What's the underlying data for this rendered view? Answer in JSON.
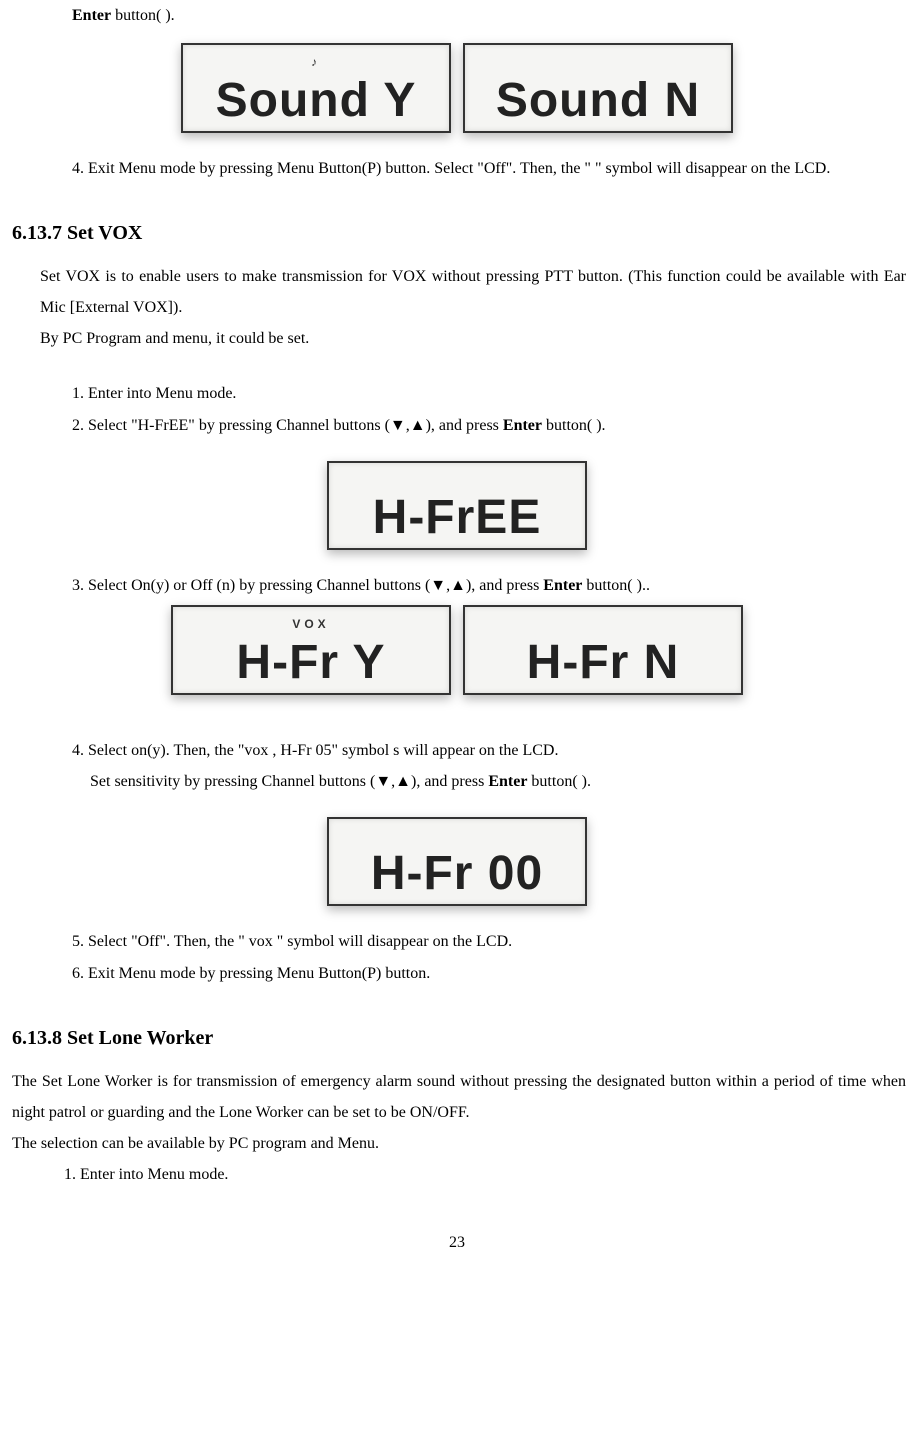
{
  "line_enter_frag_a": "Enter",
  "line_enter_frag_b": " button(      ).",
  "lcd_sound": {
    "top1": "♪",
    "left": "Sound Y",
    "right": "Sound N"
  },
  "step4_sound": "4. Exit Menu mode by pressing Menu Button(P) button. Select \"Off\". Then, the \"    \" symbol will disappear on the LCD.",
  "heading_vox": "6.13.7 Set VOX",
  "vox_intro1": "   Set VOX is to enable users to make transmission for VOX without pressing PTT button. (This function could be available with Ear Mic [External VOX]).",
  "vox_intro2": "By PC Program and menu, it could be set.",
  "vox_step1": "1. Enter into Menu mode.",
  "vox_step2_a": "2. Select \"H-FrEE\" by pressing Channel buttons (▼,▲), and press ",
  "vox_step2_b": "Enter",
  "vox_step2_c": " button(      ).",
  "lcd_hfree": {
    "text": "H-FrEE"
  },
  "vox_step3_a": "3. Select On(y) or Off (n) by pressing Channel buttons (▼,▲), and   press ",
  "vox_step3_b": "Enter",
  "vox_step3_c": " button(      )..",
  "lcd_hfr_yn": {
    "top": "VOX",
    "left": "H-Fr   Y",
    "right": "H-Fr   N"
  },
  "vox_step4_line1": "4. Select on(y). Then, the \"vox , H-Fr 05\" symbol s will appear on the LCD.",
  "vox_step4_line2_a": "Set sensitivity by pressing Channel buttons (▼,▲), and press ",
  "vox_step4_line2_b": "Enter",
  "vox_step4_line2_c": " button(      ).",
  "lcd_hfr00": {
    "text": "H-Fr 00"
  },
  "vox_step5": "5. Select \"Off\". Then, the \" vox \" symbol will disappear on the LCD.",
  "vox_step6": "6. Exit Menu mode by pressing Menu Button(P) button.",
  "heading_lone": "6.13.8 Set Lone Worker",
  "lone_p1": "The Set Lone Worker is for transmission of emergency alarm sound without pressing the designated button within a period of time when night patrol or guarding and the Lone Worker can be set to be ON/OFF.",
  "lone_p2": "The selection can be available by PC program and Menu.",
  "lone_step1": "1. Enter into Menu mode.",
  "page_num": "23"
}
